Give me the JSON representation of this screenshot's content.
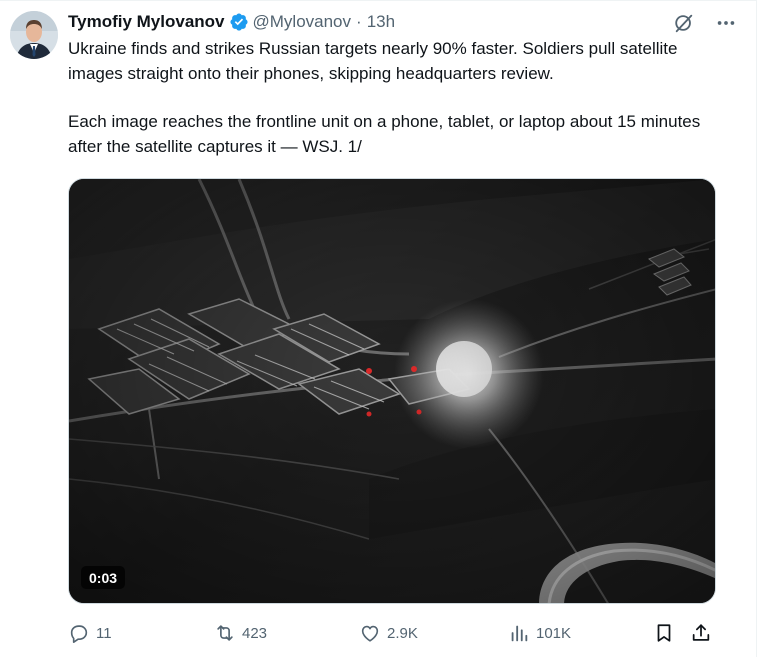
{
  "tweet": {
    "author": {
      "display_name": "Tymofiy Mylovanov",
      "handle": "@Mylovanov",
      "verified": true,
      "avatar_icon": "avatar-photo"
    },
    "separator": "·",
    "timestamp": "13h",
    "header_icons": [
      "grok-icon",
      "more-icon"
    ],
    "text_paragraphs": [
      "Ukraine finds and strikes Russian targets nearly 90% faster. Soldiers pull satellite images straight onto their phones, skipping headquarters review.",
      "Each image reaches the frontline unit on a phone, tablet, or laptop about 15 minutes after the satellite captures it — WSJ. 1/"
    ],
    "media": {
      "type": "video",
      "duration": "0:03"
    },
    "actions": {
      "replies": "11",
      "reposts": "423",
      "likes": "2.9K",
      "views": "101K"
    }
  },
  "colors": {
    "text_primary": "#0f1419",
    "text_secondary": "#536471",
    "verified_blue": "#1d9bf0",
    "border": "#cfd9de"
  }
}
